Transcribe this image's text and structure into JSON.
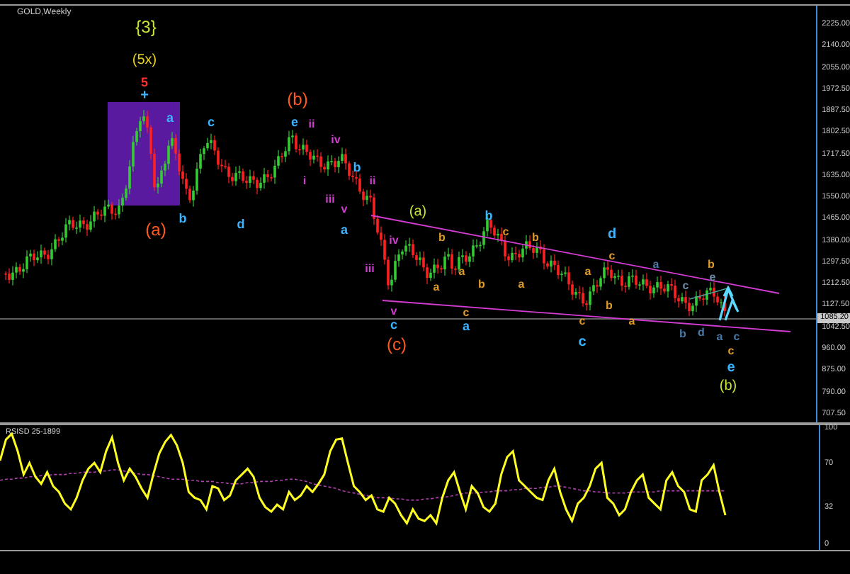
{
  "chart": {
    "title": "GOLD,Weekly",
    "current_price": "1085.20",
    "price_axis": [
      "2225.00",
      "2140.00",
      "2055.00",
      "1972.50",
      "1887.50",
      "1802.50",
      "1717.50",
      "1635.00",
      "1550.00",
      "1465.00",
      "1380.00",
      "1297.50",
      "1212.50",
      "1127.50",
      "1042.50",
      "960.00",
      "875.00",
      "790.00",
      "707.50"
    ],
    "wave_labels": [
      {
        "text": "{3}",
        "color": "#c8e632"
      },
      {
        "text": "(5x)",
        "color": "#e6d21e"
      },
      {
        "text": "5",
        "color": "#ff3030"
      },
      {
        "text": "+",
        "color": "#3cb4ff"
      },
      {
        "text": "a",
        "color": "#3cb4ff"
      },
      {
        "text": "(a)",
        "color": "#ff5a1e"
      },
      {
        "text": "b",
        "color": "#3cb4ff"
      },
      {
        "text": "c",
        "color": "#3cb4ff"
      },
      {
        "text": "d",
        "color": "#3cb4ff"
      },
      {
        "text": "(b)",
        "color": "#ff5a1e"
      },
      {
        "text": "e",
        "color": "#3cb4ff"
      },
      {
        "text": "ii",
        "color": "#d23cd2"
      },
      {
        "text": "i",
        "color": "#d23cd2"
      },
      {
        "text": "iv",
        "color": "#d23cd2"
      },
      {
        "text": "iii",
        "color": "#d23cd2"
      },
      {
        "text": "v",
        "color": "#d23cd2"
      },
      {
        "text": "a",
        "color": "#3cb4ff"
      },
      {
        "text": "b",
        "color": "#3cb4ff"
      },
      {
        "text": "ii",
        "color": "#d23cd2"
      },
      {
        "text": "iv",
        "color": "#d23cd2"
      },
      {
        "text": "iii",
        "color": "#d23cd2"
      },
      {
        "text": "(a)",
        "color": "#c8e632"
      },
      {
        "text": "v",
        "color": "#d23cd2"
      },
      {
        "text": "c",
        "color": "#3cb4ff"
      },
      {
        "text": "(c)",
        "color": "#ff5a1e"
      },
      {
        "text": "b",
        "color": "#e09a28"
      },
      {
        "text": "a",
        "color": "#e09a28"
      },
      {
        "text": "b",
        "color": "#3cb4ff"
      },
      {
        "text": "c",
        "color": "#e09a28"
      },
      {
        "text": "b",
        "color": "#e09a28"
      },
      {
        "text": "a",
        "color": "#e09a28"
      },
      {
        "text": "b",
        "color": "#e09a28"
      },
      {
        "text": "a",
        "color": "#e09a28"
      },
      {
        "text": "c",
        "color": "#e09a28"
      },
      {
        "text": "a",
        "color": "#3cb4ff"
      },
      {
        "text": "a",
        "color": "#e09a28"
      },
      {
        "text": "d",
        "color": "#3cb4ff"
      },
      {
        "text": "c",
        "color": "#e09a28"
      },
      {
        "text": "b",
        "color": "#e09a28"
      },
      {
        "text": "c",
        "color": "#e09a28"
      },
      {
        "text": "c",
        "color": "#3cb4ff"
      },
      {
        "text": "a",
        "color": "#e09a28"
      },
      {
        "text": "a",
        "color": "#4a78a8"
      },
      {
        "text": "b",
        "color": "#e09a28"
      },
      {
        "text": "c",
        "color": "#6a8aa8"
      },
      {
        "text": "e",
        "color": "#6a8aa8"
      },
      {
        "text": "b",
        "color": "#4a78a8"
      },
      {
        "text": "d",
        "color": "#4a78a8"
      },
      {
        "text": "a",
        "color": "#4a78a8"
      },
      {
        "text": "c",
        "color": "#4a78a8"
      },
      {
        "text": "c",
        "color": "#e09a28"
      },
      {
        "text": "e",
        "color": "#3cb4ff"
      },
      {
        "text": "(b)",
        "color": "#c8e632"
      }
    ]
  },
  "indicator": {
    "title": "RSISD 25-1899",
    "chart_data": {
      "type": "line",
      "ylim": [
        0,
        100
      ],
      "categories": [
        null,
        null,
        null,
        null,
        null,
        null,
        null,
        null,
        null,
        null,
        null,
        null,
        null,
        null,
        null,
        null,
        null,
        null,
        null,
        null,
        null,
        null,
        null,
        null,
        null,
        null,
        null,
        null,
        null,
        null,
        null,
        null,
        null,
        null,
        null,
        null,
        null,
        null,
        null,
        null,
        null,
        null,
        null,
        null,
        null,
        null,
        null,
        null,
        null,
        null,
        null,
        null,
        null,
        null,
        null,
        null,
        null,
        null,
        null,
        null,
        null,
        null,
        null,
        null,
        null,
        null,
        null,
        null,
        null,
        null,
        null,
        null,
        null,
        null,
        null,
        null,
        null,
        null,
        null,
        null,
        null,
        null,
        null,
        null,
        null,
        null,
        null,
        null,
        null,
        null,
        null,
        null,
        null,
        null,
        null,
        null,
        null,
        null,
        null,
        null,
        null,
        null,
        null,
        null,
        null,
        null,
        null,
        null,
        null,
        null,
        null,
        null,
        null,
        null,
        null,
        null,
        null,
        null,
        null,
        null,
        null,
        null,
        null,
        null
      ],
      "yticks": [
        100,
        70,
        32,
        0
      ],
      "series": [
        {
          "color": "#ffff20",
          "line_style": "solid",
          "values": [
            72,
            90,
            95,
            80,
            60,
            70,
            58,
            52,
            62,
            50,
            45,
            35,
            30,
            40,
            55,
            65,
            70,
            62,
            80,
            92,
            70,
            55,
            65,
            58,
            48,
            40,
            60,
            78,
            88,
            94,
            85,
            70,
            45,
            40,
            38,
            30,
            50,
            48,
            38,
            42,
            55,
            60,
            65,
            58,
            40,
            32,
            28,
            34,
            30,
            45,
            38,
            42,
            50,
            45,
            52,
            60,
            80,
            90,
            91,
            70,
            50,
            45,
            38,
            42,
            30,
            28,
            40,
            35,
            25,
            18,
            30,
            22,
            20,
            25,
            18,
            40,
            55,
            62,
            45,
            30,
            50,
            44,
            32,
            28,
            35,
            60,
            75,
            80,
            55,
            50,
            45,
            40,
            38,
            55,
            65,
            45,
            30,
            20,
            35,
            40,
            50,
            65,
            70,
            40,
            35,
            25,
            30,
            45,
            55,
            60,
            40,
            35,
            30,
            55,
            62,
            50,
            45,
            30,
            28,
            55,
            60,
            68,
            45,
            25
          ]
        },
        {
          "color": "#b040b0",
          "line_style": "dashed",
          "values": [
            55,
            56,
            56,
            57,
            57,
            58,
            58,
            59,
            59,
            60,
            60,
            60,
            61,
            61,
            62,
            62,
            62,
            63,
            63,
            64,
            64,
            63,
            62,
            61,
            60,
            60,
            59,
            58,
            57,
            56,
            56,
            56,
            55,
            55,
            54,
            54,
            54,
            53,
            53,
            52,
            52,
            52,
            53,
            53,
            54,
            54,
            54,
            55,
            55,
            56,
            56,
            55,
            54,
            52,
            51,
            50,
            49,
            48,
            46,
            45,
            44,
            43,
            42,
            41,
            40,
            40,
            40,
            39,
            39,
            38,
            38,
            38,
            39,
            39,
            40,
            40,
            41,
            42,
            43,
            44,
            44,
            44,
            45,
            45,
            46,
            46,
            46,
            47,
            47,
            48,
            48,
            48,
            49,
            49,
            50,
            50,
            49,
            48,
            47,
            46,
            46,
            45,
            45,
            44,
            44,
            44,
            44,
            45,
            45,
            45,
            45,
            45,
            46,
            46,
            46,
            46,
            46,
            46,
            46,
            46,
            46,
            46,
            46,
            46
          ]
        }
      ]
    }
  }
}
